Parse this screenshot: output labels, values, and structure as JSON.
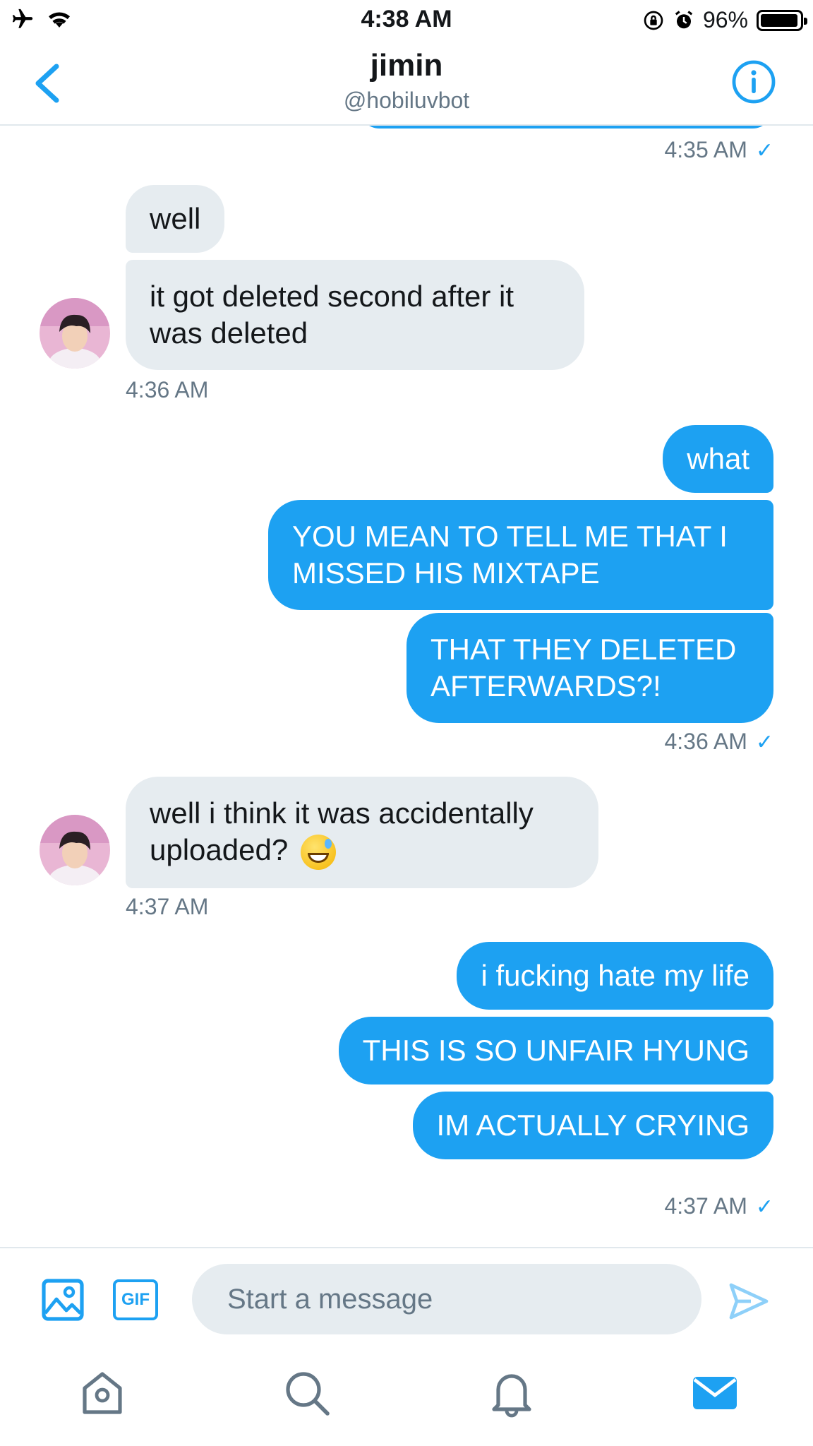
{
  "status_bar": {
    "time": "4:38 AM",
    "battery": "96%",
    "battery_level": 0.96
  },
  "header": {
    "back_icon": "chevron-left-icon",
    "title": "jimin",
    "subtitle": "@hobiluvbot",
    "info_icon": "info-icon"
  },
  "conversation": {
    "top_timestamp": "4:35 AM",
    "messages": [
      {
        "from": "them",
        "text": "well"
      },
      {
        "from": "them",
        "text": "it got deleted second after it was deleted"
      },
      {
        "from": "them",
        "timestamp": "4:36 AM"
      },
      {
        "from": "me",
        "text": "what"
      },
      {
        "from": "me",
        "text": "YOU MEAN TO TELL ME THAT I MISSED HIS MIXTAPE"
      },
      {
        "from": "me",
        "text": "THAT THEY DELETED AFTERWARDS?!"
      },
      {
        "from": "me",
        "timestamp": "4:36 AM"
      },
      {
        "from": "them",
        "text": "well i think it was accidentally uploaded?",
        "emoji": "grinning-face-with-sweat"
      },
      {
        "from": "them",
        "timestamp": "4:37 AM"
      },
      {
        "from": "me",
        "text": "i fucking hate my life"
      },
      {
        "from": "me",
        "text": "THIS IS SO UNFAIR HYUNG"
      },
      {
        "from": "me",
        "text": "IM ACTUALLY CRYING"
      },
      {
        "from": "me",
        "timestamp": "4:37 AM"
      }
    ],
    "read_check": "✓"
  },
  "composer": {
    "placeholder": "Start a message",
    "value": "",
    "gif_label": "GIF",
    "media_icon": "image-icon",
    "send_icon": "send-icon"
  },
  "tabbar": {
    "items": [
      "home-icon",
      "search-icon",
      "notifications-icon",
      "messages-icon"
    ],
    "active": "messages-icon"
  },
  "colors": {
    "accent": "#1da1f2",
    "incoming_bubble": "#e6ecf0",
    "secondary_text": "#657786"
  }
}
